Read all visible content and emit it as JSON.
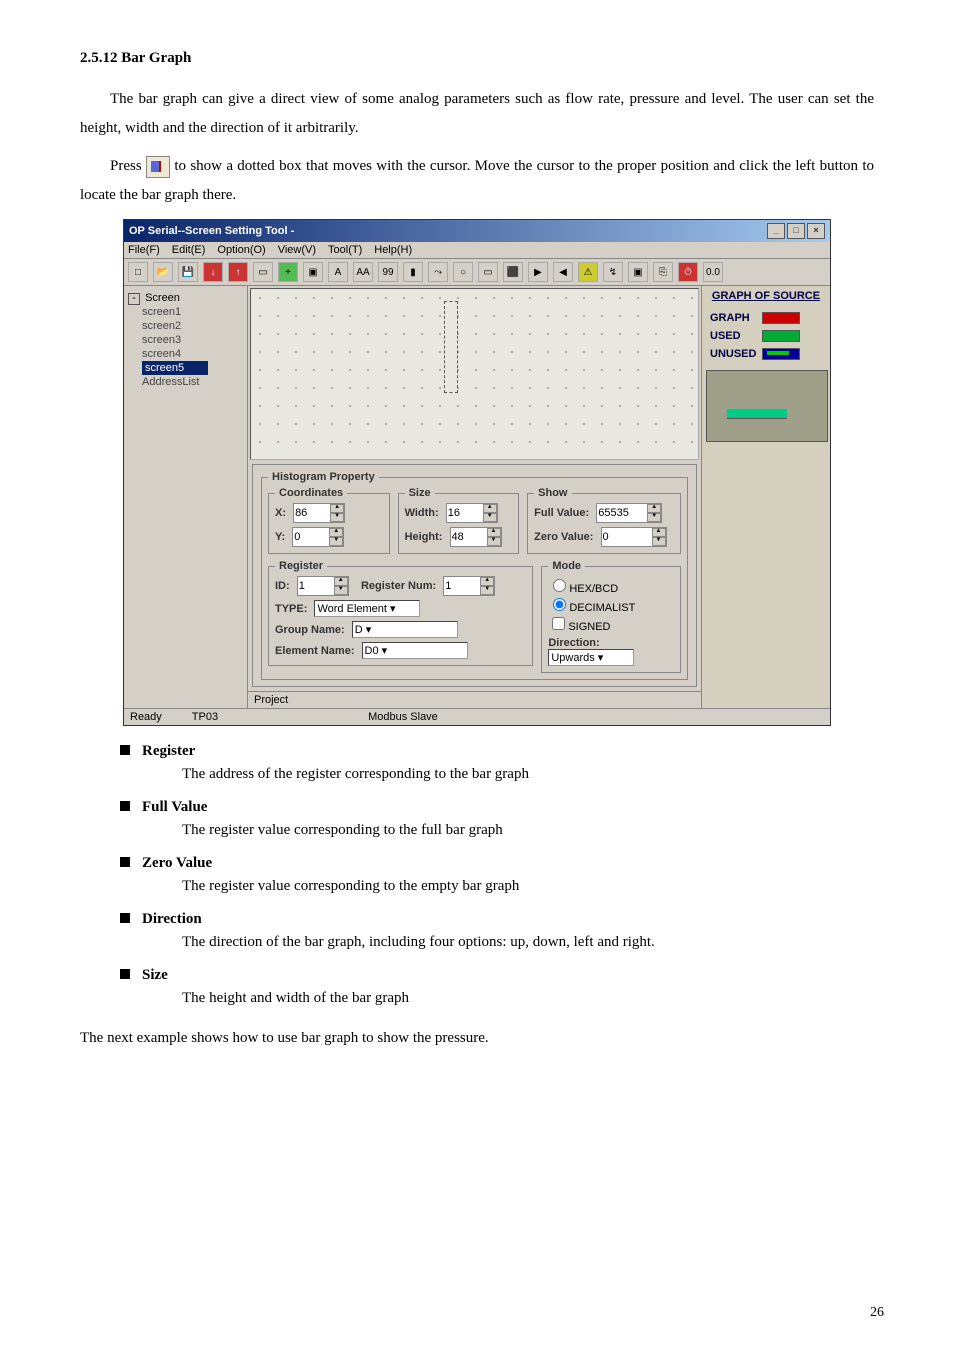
{
  "section_title": "2.5.12 Bar Graph",
  "para1a": "The bar graph can give a direct view of some analog parameters such as flow rate, pressure and level. The user can set the height, width and the direction of it arbitrarily.",
  "para2a": "Press ",
  "para2b": " to show a dotted box that moves with the cursor. Move the cursor to the proper position and click the left button to locate the bar graph there.",
  "window": {
    "title": "OP Serial--Screen Setting Tool -",
    "menus": {
      "file": "File(F)",
      "edit": "Edit(E)",
      "option": "Option(O)",
      "view": "View(V)",
      "tool": "Tool(T)",
      "help": "Help(H)"
    },
    "toolbar": {
      "a": "A",
      "aa": "AA",
      "nn": "99",
      "zero": "0.0"
    },
    "tree": {
      "root": "Screen",
      "items": [
        "screen1",
        "screen2",
        "screen3",
        "screen4",
        "screen5",
        "AddressList"
      ],
      "selected": "screen5"
    },
    "right": {
      "title": "GRAPH OF SOURCE",
      "graph": "GRAPH",
      "used": "USED",
      "unused": "UNUSED"
    },
    "prop": {
      "legend": "Histogram Property",
      "coord_legend": "Coordinates",
      "xlabel": "X:",
      "xval": "86",
      "ylabel": "Y:",
      "yval": "0",
      "size_legend": "Size",
      "width_label": "Width:",
      "width_val": "16",
      "height_label": "Height:",
      "height_val": "48",
      "show_legend": "Show",
      "full_label": "Full Value:",
      "full_val": "65535",
      "zero_label": "Zero Value:",
      "zero_val": "0",
      "reg_legend": "Register",
      "id_label": "ID:",
      "id_val": "1",
      "regnum_label": "Register Num:",
      "regnum_val": "1",
      "type_label": "TYPE:",
      "type_val": "Word Element",
      "group_label": "Group Name:",
      "group_val": "D",
      "elem_label": "Element Name:",
      "elem_val": "D0",
      "mode_legend": "Mode",
      "mode_hex": "HEX/BCD",
      "mode_dec": "DECIMALIST",
      "mode_signed": "SIGNED",
      "dir_label": "Direction:",
      "dir_val": "Upwards"
    },
    "project_tab": "Project",
    "status": {
      "ready": "Ready",
      "model": "TP03",
      "mode": "Modbus Slave"
    }
  },
  "bullets": {
    "register_h": "Register",
    "register_t": "The address of the register corresponding to the bar graph",
    "full_h": "Full Value",
    "full_t": "The register value corresponding to the full bar graph",
    "zero_h": "Zero Value",
    "zero_t": "The register value corresponding to the empty bar graph",
    "dir_h": "Direction",
    "dir_t": "The direction of the bar graph, including four options: up, down, left and right.",
    "size_h": "Size",
    "size_t": "The height and width of the bar graph"
  },
  "closing": "The next example shows how to use bar graph to show the pressure.",
  "pagenum": "26"
}
